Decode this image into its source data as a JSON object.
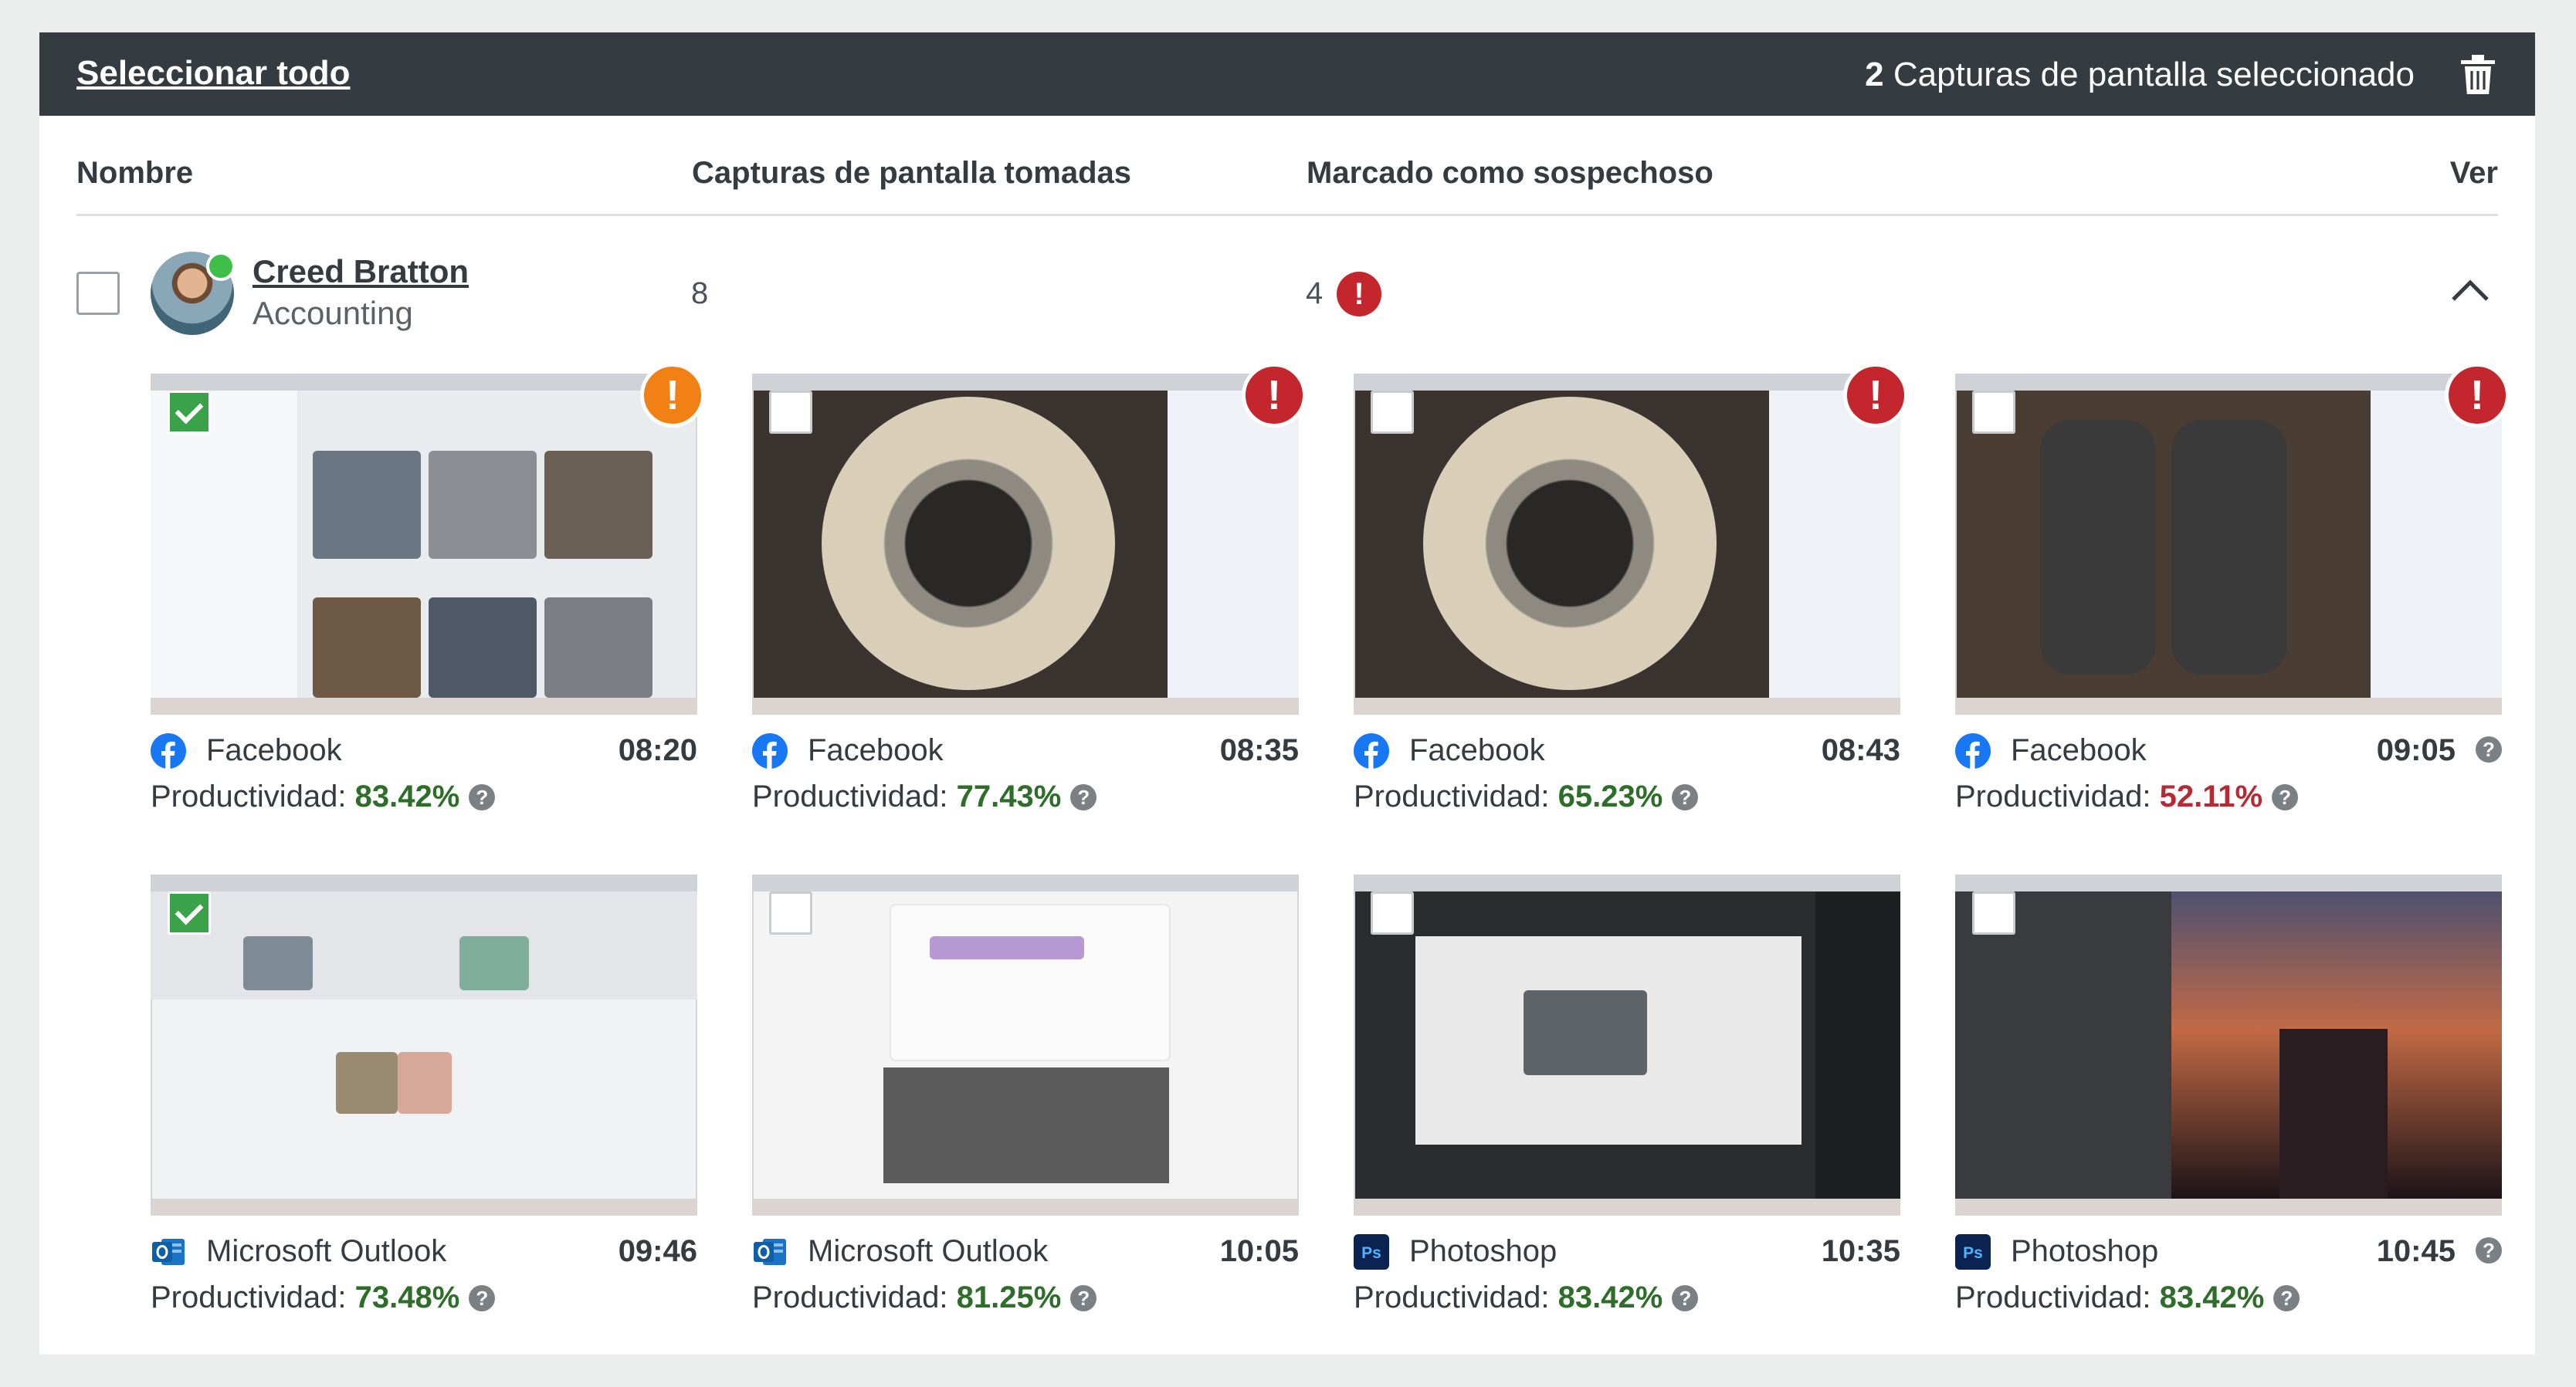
{
  "toolbar": {
    "select_all": "Seleccionar todo",
    "selected_count": "2",
    "selected_text": "Capturas de pantalla seleccionado"
  },
  "columns": {
    "name": "Nombre",
    "screenshots_taken": "Capturas de pantalla tomadas",
    "flagged": "Marcado como sospechoso",
    "view": "Ver"
  },
  "user": {
    "name": "Creed Bratton",
    "department": "Accounting",
    "screenshots_taken": "8",
    "flagged_count": "4",
    "online": true
  },
  "labels": {
    "productivity": "Productividad:"
  },
  "colors": {
    "good": "#2f6d2a",
    "bad": "#b52b33",
    "alert_red": "#c4262e",
    "alert_orange": "#f18015",
    "check_green": "#3aa34a"
  },
  "screenshots": [
    {
      "app": "Facebook",
      "icon": "facebook-icon",
      "time": "08:20",
      "productivity": "83.42%",
      "level": "good",
      "selected": true,
      "alert": "orange",
      "help": false
    },
    {
      "app": "Facebook",
      "icon": "facebook-icon",
      "time": "08:35",
      "productivity": "77.43%",
      "level": "good",
      "selected": false,
      "alert": "red",
      "help": false
    },
    {
      "app": "Facebook",
      "icon": "facebook-icon",
      "time": "08:43",
      "productivity": "65.23%",
      "level": "good",
      "selected": false,
      "alert": "red",
      "help": false
    },
    {
      "app": "Facebook",
      "icon": "facebook-icon",
      "time": "09:05",
      "productivity": "52.11%",
      "level": "bad",
      "selected": false,
      "alert": "red",
      "help": true
    },
    {
      "app": "Microsoft Outlook",
      "icon": "outlook-icon",
      "time": "09:46",
      "productivity": "73.48%",
      "level": "good",
      "selected": true,
      "alert": "",
      "help": false
    },
    {
      "app": "Microsoft Outlook",
      "icon": "outlook-icon",
      "time": "10:05",
      "productivity": "81.25%",
      "level": "good",
      "selected": false,
      "alert": "",
      "help": false
    },
    {
      "app": "Photoshop",
      "icon": "photoshop-icon",
      "time": "10:35",
      "productivity": "83.42%",
      "level": "good",
      "selected": false,
      "alert": "",
      "help": false
    },
    {
      "app": "Photoshop",
      "icon": "photoshop-icon",
      "time": "10:45",
      "productivity": "83.42%",
      "level": "good",
      "selected": false,
      "alert": "",
      "help": true
    }
  ]
}
